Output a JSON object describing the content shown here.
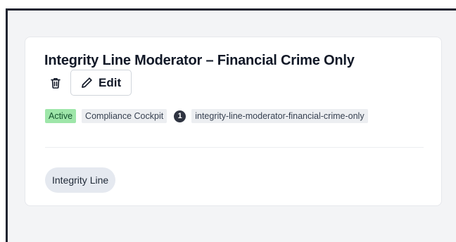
{
  "card": {
    "title": "Integrity Line Moderator – Financial Crime Only",
    "actions": {
      "delete_icon": "trash-icon",
      "edit_icon": "pencil-icon",
      "edit_label": "Edit"
    },
    "badges": {
      "status": "Active",
      "category": "Compliance Cockpit",
      "count": "1",
      "slug": "integrity-line-moderator-financial-crime-only"
    },
    "tags": [
      "Integrity Line"
    ]
  },
  "colors": {
    "active_badge_bg": "#9ee6a9",
    "gray_badge_bg": "#eceef1",
    "tag_bg": "#e5e9f0",
    "count_badge_bg": "#2f3441"
  }
}
